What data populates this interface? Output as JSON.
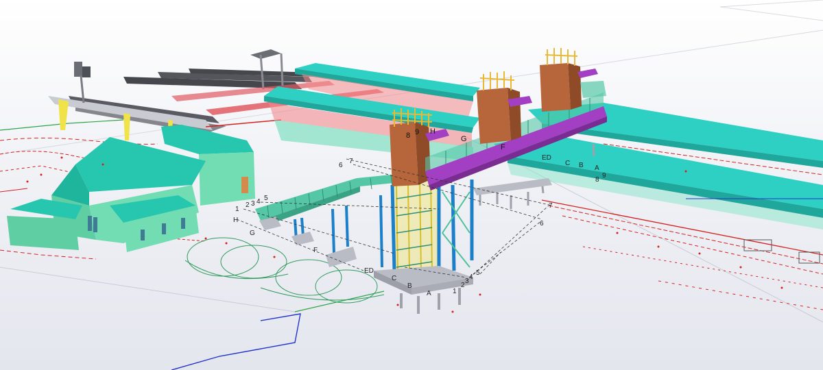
{
  "viewport": {
    "background_top": "#ffffff",
    "background_bottom": "#e4e6ee"
  },
  "model_colors": {
    "canopy_roof": "#2ed0c3",
    "canopy_roof_dark": "#1fa79c",
    "building_roof": "#27c6ae",
    "building_wall": "#72dcb3",
    "cladding_brown": "#b7653a",
    "footbridge_deck": "#a23fc2",
    "steel_blue": "#1c7fc9",
    "steel_teal": "#4cc29a",
    "stair_green": "#55c7a6",
    "concrete": "#b9bcc4",
    "platform_red": "#e05a63",
    "pipe_red": "#d62020",
    "canopy_column_yellow": "#f0e34a",
    "rail_dark": "#46474d",
    "service_green": "#2ea34a",
    "service_blue": "#2233cc"
  },
  "grid_labels": {
    "left_tower": {
      "col_8": "8",
      "col_9": "9",
      "col_H": "H",
      "col_G": "G",
      "col_F": "F"
    },
    "left_stair": {
      "n1": "1",
      "n2": "2",
      "n3": "3",
      "n4": "4",
      "n5": "5",
      "n6": "6",
      "n7": "7",
      "H": "H",
      "G": "G",
      "F": "F",
      "ED": "ED",
      "C": "C",
      "B": "B",
      "A": "A"
    },
    "right_bridge": {
      "ED": "ED",
      "C": "C",
      "B": "B",
      "A": "A",
      "n9": "9",
      "n8": "8",
      "n7": "7",
      "n6": "6"
    },
    "base_right": {
      "n5": "5",
      "n4": "4",
      "n3": "3",
      "n2": "2",
      "n1": "1"
    }
  }
}
